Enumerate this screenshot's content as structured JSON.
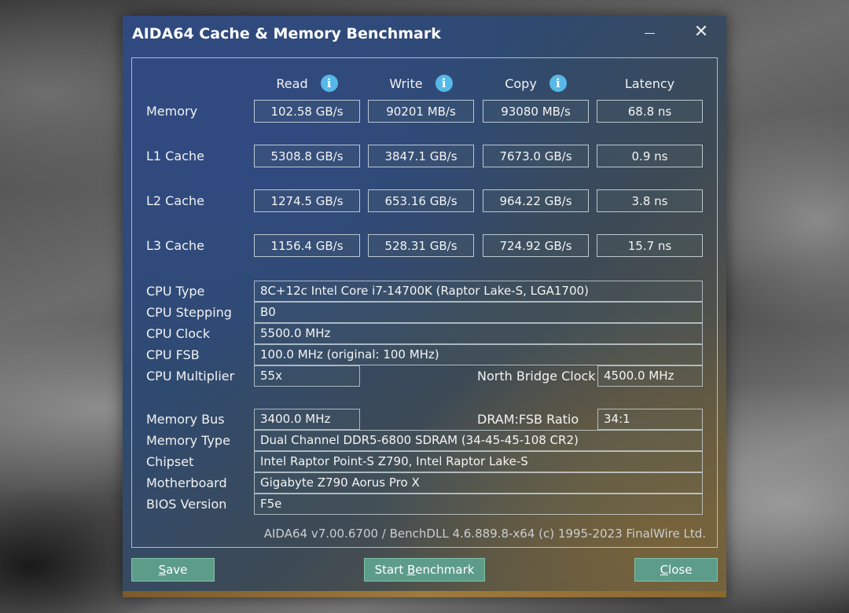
{
  "window": {
    "title": "AIDA64 Cache & Memory Benchmark"
  },
  "columns": {
    "read": "Read",
    "write": "Write",
    "copy": "Copy",
    "latency": "Latency"
  },
  "results": [
    {
      "label": "Memory",
      "read": "102.58 GB/s",
      "write": "90201 MB/s",
      "copy": "93080 MB/s",
      "latency": "68.8 ns"
    },
    {
      "label": "L1 Cache",
      "read": "5308.8 GB/s",
      "write": "3847.1 GB/s",
      "copy": "7673.0 GB/s",
      "latency": "0.9 ns"
    },
    {
      "label": "L2 Cache",
      "read": "1274.5 GB/s",
      "write": "653.16 GB/s",
      "copy": "964.22 GB/s",
      "latency": "3.8 ns"
    },
    {
      "label": "L3 Cache",
      "read": "1156.4 GB/s",
      "write": "528.31 GB/s",
      "copy": "724.92 GB/s",
      "latency": "15.7 ns"
    }
  ],
  "cpu": {
    "type_label": "CPU Type",
    "type_value": "8C+12c Intel Core i7-14700K  (Raptor Lake-S, LGA1700)",
    "stepping_label": "CPU Stepping",
    "stepping_value": "B0",
    "clock_label": "CPU Clock",
    "clock_value": "5500.0 MHz",
    "fsb_label": "CPU FSB",
    "fsb_value": "100.0 MHz  (original: 100 MHz)",
    "multiplier_label": "CPU Multiplier",
    "multiplier_value": "55x",
    "nb_clock_label": "North Bridge Clock",
    "nb_clock_value": "4500.0 MHz"
  },
  "memory": {
    "bus_label": "Memory Bus",
    "bus_value": "3400.0 MHz",
    "ratio_label": "DRAM:FSB Ratio",
    "ratio_value": "34:1",
    "type_label": "Memory Type",
    "type_value": "Dual Channel DDR5-6800 SDRAM  (34-45-45-108 CR2)",
    "chipset_label": "Chipset",
    "chipset_value": "Intel Raptor Point-S Z790, Intel Raptor Lake-S",
    "motherboard_label": "Motherboard",
    "motherboard_value": "Gigabyte Z790 Aorus Pro X",
    "bios_label": "BIOS Version",
    "bios_value": "F5e"
  },
  "footer": "AIDA64 v7.00.6700 / BenchDLL 4.6.889.8-x64  (c) 1995-2023 FinalWire Ltd.",
  "buttons": {
    "save_first": "S",
    "save_rest": "ave",
    "start_pre": "Start ",
    "start_key": "B",
    "start_rest": "enchmark",
    "close_first": "C",
    "close_rest": "lose"
  },
  "icons": {
    "info": "info-icon",
    "close": "close-icon",
    "minimize": "minimize-icon"
  },
  "colors": {
    "button_bg": "#5d9c88",
    "info_icon": "#56b8e8"
  }
}
